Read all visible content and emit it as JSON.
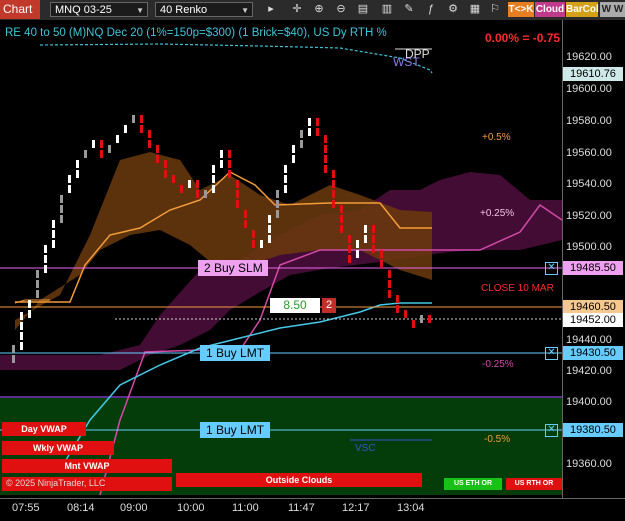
{
  "toolbar": {
    "chart_label": "Chart",
    "instrument": "MNQ 03-25",
    "bar_type": "40 Renko",
    "tool_icons": [
      "pointer-icon",
      "zoom-in-icon",
      "zoom-out-icon",
      "properties-icon",
      "chart-type-icon",
      "drawing-icon",
      "indicator-icon",
      "strategy-icon",
      "template-icon",
      "attach-icon",
      "data-box-icon",
      "position-icon"
    ],
    "tck_label": "T<>K",
    "cloud_label": "Cloud",
    "barcol_label": "BarCol",
    "w_label": "W W"
  },
  "header": {
    "title": "RE 40 to 50 (M)NQ Dec 20 (1%=150p=$300) (1 Brick=$40), US Dy RTH %",
    "pct_change": "0.00% = -0.75",
    "wst": "WST",
    "dpp": "DPP"
  },
  "price_axis": {
    "ticks": [
      "19620.00",
      "19600.00",
      "19580.00",
      "19560.00",
      "19540.00",
      "19520.00",
      "19500.00",
      "19440.00",
      "19420.00",
      "19400.00",
      "19360.00"
    ],
    "tags": {
      "upper_line": "19610.76",
      "sell_order": "19485.50",
      "orange_level": "19460.50",
      "last_price": "19452.00",
      "buy_lmt_1": "19430.50",
      "buy_lmt_2": "19380.50"
    }
  },
  "time_axis": [
    "07:55",
    "08:14",
    "09:00",
    "10:00",
    "11:00",
    "11:47",
    "12:17",
    "13:04"
  ],
  "levels": {
    "plus_05": "+0.5%",
    "plus_025": "+0.25%",
    "minus_025": "-0.25%",
    "minus_05": "-0.5%",
    "close_label": "CLOSE 10 MAR"
  },
  "orders": {
    "sell_order_label": "2 Buy SLM",
    "buy_lmt_1_label": "1 Buy LMT",
    "buy_lmt_2_label": "1 Buy LMT",
    "position_price": "8.50",
    "position_qty": "2"
  },
  "bottom_labels": {
    "day_vwap": "Day VWAP",
    "wkly_vwap": "Wkly VWAP",
    "mnt_vwap": "Mnt VWAP",
    "outside_clouds": "Outside Clouds",
    "us_eth_or": "US ETH OR",
    "us_rth_or": "US RTH OR",
    "vsc": "VSC",
    "copyright": "© 2025 NinjaTrader, LLC"
  },
  "colors": {
    "brick_up": "#ffffff",
    "brick_down": "#e01010",
    "buy_line": "#66ccff",
    "sell_line": "#ee66ee",
    "orange": "#f39c3b",
    "cloud": "#4a0d3a",
    "green_zone": "#043d0a"
  }
}
